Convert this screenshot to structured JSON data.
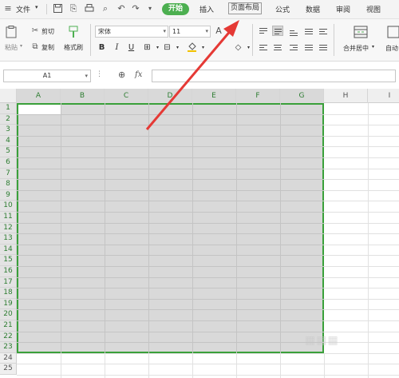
{
  "menubar": {
    "file_label": "文件",
    "tabs": {
      "start": "开始",
      "insert": "插入",
      "page_layout": "页面布局",
      "formula": "公式",
      "data": "数据",
      "review": "审阅",
      "view": "视图"
    }
  },
  "ribbon": {
    "paste_label": "粘贴",
    "cut_label": "剪切",
    "copy_label": "复制",
    "format_painter_label": "格式刷",
    "font_name": "宋体",
    "font_size": "11",
    "bold": "B",
    "italic": "I",
    "underline": "U",
    "merge_center_label": "合并居中",
    "auto_wrap_label": "自动"
  },
  "formula_bar": {
    "cell_ref": "A1",
    "fx": "fx"
  },
  "grid": {
    "columns": [
      "A",
      "B",
      "C",
      "D",
      "E",
      "F",
      "G",
      "H",
      "I"
    ],
    "rows": [
      "1",
      "2",
      "3",
      "4",
      "5",
      "6",
      "7",
      "8",
      "9",
      "10",
      "11",
      "12",
      "13",
      "14",
      "15",
      "16",
      "17",
      "18",
      "19",
      "20",
      "21",
      "22",
      "23",
      "24",
      "25"
    ]
  },
  "colors": {
    "accent": "#4caf50",
    "selection_border": "#3aa03a",
    "annotation_arrow": "#e53935"
  }
}
